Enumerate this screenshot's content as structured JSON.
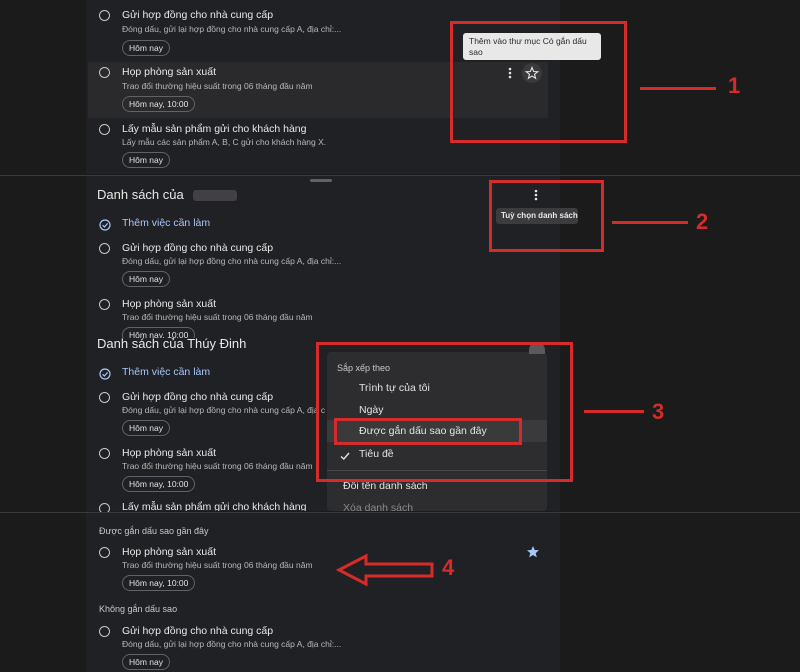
{
  "panel1": {
    "items": [
      {
        "title": "Gửi hợp đồng cho nhà cung cấp",
        "desc": "Đóng dấu, gửi lại hợp đồng cho nhà cung cấp A, địa chỉ:...",
        "date": "Hôm nay"
      },
      {
        "title": "Họp phòng sản xuất",
        "desc": "Trao đổi thường hiệu suất trong 06 tháng đầu năm",
        "date": "Hôm nay, 10:00"
      },
      {
        "title": "Lấy mẫu sản phẩm gửi cho khách hàng",
        "desc": "Lấy mẫu các sản phẩm A, B, C gửi cho khách hàng X.",
        "date": "Hôm nay"
      }
    ],
    "tooltip": "Thêm vào thư mục Có gắn dấu sao"
  },
  "panel2": {
    "list_title": "Danh sách của",
    "add_task": "Thêm việc cần làm",
    "tooltip": "Tuỳ chọn danh sách",
    "items": [
      {
        "title": "Gửi hợp đồng cho nhà cung cấp",
        "desc": "Đóng dấu, gửi lại hợp đồng cho nhà cung cấp A, địa chỉ:...",
        "date": "Hôm nay"
      },
      {
        "title": "Họp phòng sản xuất",
        "desc": "Trao đổi thường hiệu suất trong 06 tháng đầu năm",
        "date": "Hôm nay, 10:00"
      }
    ]
  },
  "panel3": {
    "list_title": "Danh sách của Thúy Đinh",
    "add_task": "Thêm việc cần làm",
    "items": [
      {
        "title": "Gửi hợp đồng cho nhà cung cấp",
        "desc": "Đóng dấu, gửi lại hợp đồng cho nhà cung cấp A, địa c",
        "date": "Hôm nay"
      },
      {
        "title": "Họp phòng sản xuất",
        "desc": "Trao đổi thường hiệu suất trong 06 tháng đầu năm",
        "date": "Hôm nay, 10:00"
      },
      {
        "title": "Lấy mẫu sản phẩm gửi cho khách hàng",
        "desc": "",
        "date": ""
      }
    ],
    "menu": {
      "header": "Sắp xếp theo",
      "options": [
        "Trình tự của tôi",
        "Ngày",
        "Được gắn dấu sao gần đây",
        "Tiêu đề"
      ],
      "checked_option": "Tiêu đề",
      "rename": "Đổi tên danh sách",
      "delete": "Xóa danh sách"
    }
  },
  "panel4": {
    "starred_label": "Được gắn dấu sao gần đây",
    "starred_item": {
      "title": "Họp phòng sản xuất",
      "desc": "Trao đổi thường hiệu suất trong 06 tháng đầu năm",
      "date": "Hôm nay, 10:00"
    },
    "unstarred_label": "Không gắn dấu sao",
    "unstarred_item": {
      "title": "Gửi hợp đồng cho nhà cung cấp",
      "desc": "Đóng dấu, gửi lại hợp đồng cho nhà cung cấp A, địa chỉ:...",
      "date": "Hôm nay"
    }
  },
  "annotations": {
    "n1": "1",
    "n2": "2",
    "n3": "3",
    "n4": "4"
  },
  "colors": {
    "annotation_red": "#d62b2b",
    "link_blue": "#a8c7fa",
    "star_blue": "#a8c7fa"
  }
}
